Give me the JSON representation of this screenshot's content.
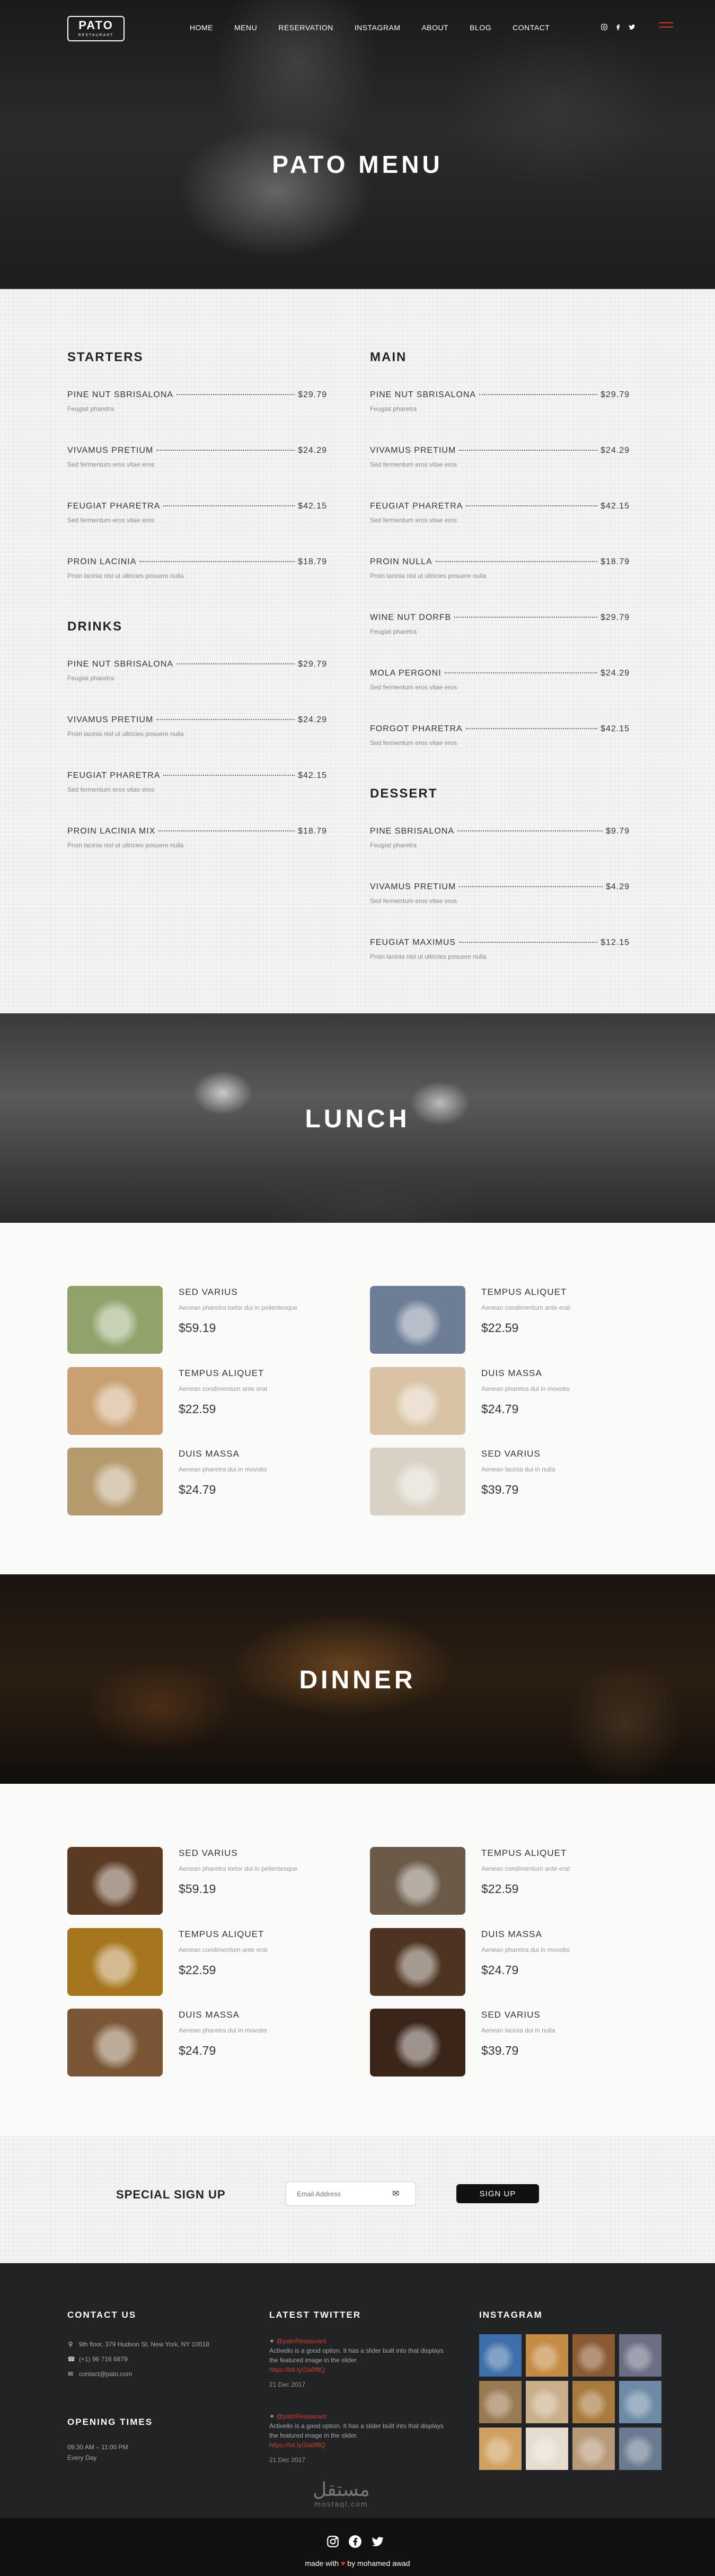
{
  "nav": {
    "logo_main": "PATO",
    "logo_sub": "RESTAURANT",
    "links": [
      "HOME",
      "MENU",
      "RESERVATION",
      "INSTAGRAM",
      "ABOUT",
      "BLOG",
      "CONTACT"
    ],
    "social_icons": [
      "instagram-icon",
      "facebook-icon",
      "twitter-icon"
    ]
  },
  "hero": {
    "title": "PATO MENU"
  },
  "menu": {
    "starters": {
      "title": "STARTERS",
      "items": [
        {
          "name": "PINE NUT SBRISALONA",
          "price": "$29.79",
          "desc": "Feugiat pharetra"
        },
        {
          "name": "VIVAMUS PRETIUM",
          "price": "$24.29",
          "desc": "Sed fermentum eros vitae eros"
        },
        {
          "name": "FEUGIAT PHARETRA",
          "price": "$42.15",
          "desc": "Sed fermentum eros vitae eros"
        },
        {
          "name": "PROIN LACINIA",
          "price": "$18.79",
          "desc": "Proin lacinia nisl ut ultricies posuere nulla"
        }
      ]
    },
    "drinks": {
      "title": "DRINKS",
      "items": [
        {
          "name": "PINE NUT SBRISALONA",
          "price": "$29.79",
          "desc": "Feugiat pharetra"
        },
        {
          "name": "VIVAMUS PRETIUM",
          "price": "$24.29",
          "desc": "Proin lacinia nisl ut ultricies posuere nulla"
        },
        {
          "name": "FEUGIAT PHARETRA",
          "price": "$42.15",
          "desc": "Sed fermentum eros vitae eros"
        },
        {
          "name": "PROIN LACINIA MIX",
          "price": "$18.79",
          "desc": "Proin lacinia nisl ut ultricies posuere nulla"
        }
      ]
    },
    "main": {
      "title": "MAIN",
      "items": [
        {
          "name": "PINE NUT SBRISALONA",
          "price": "$29.79",
          "desc": "Feugiat pharetra"
        },
        {
          "name": "VIVAMUS PRETIUM",
          "price": "$24.29",
          "desc": "Sed fermentum eros vitae eros"
        },
        {
          "name": "FEUGIAT PHARETRA",
          "price": "$42.15",
          "desc": "Sed fermentum eros vitae eros"
        },
        {
          "name": "PROIN NULLA",
          "price": "$18.79",
          "desc": "Proin lacinia nisl ut ultricies posuere nulla"
        },
        {
          "name": "WINE NUT DORFB",
          "price": "$29.79",
          "desc": "Feugiat pharetra"
        },
        {
          "name": "MOLA PERGONI",
          "price": "$24.29",
          "desc": "Sed fermentum eros vitae eros"
        },
        {
          "name": "FORGOT PHARETRA",
          "price": "$42.15",
          "desc": "Sed fermentum eros vitae eros"
        }
      ]
    },
    "dessert": {
      "title": "DESSERT",
      "items": [
        {
          "name": "PINE SBRISALONA",
          "price": "$9.79",
          "desc": "Feugiat pharetra"
        },
        {
          "name": "VIVAMUS PRETIUM",
          "price": "$4.29",
          "desc": "Sed fermentum eros vitae eros"
        },
        {
          "name": "FEUGIAT MAXIMUS",
          "price": "$12.15",
          "desc": "Proin lacinia nisl ut ultricies posuere nulla"
        }
      ]
    }
  },
  "lunch": {
    "title": "LUNCH",
    "dishes": [
      {
        "name": "SED VARIUS",
        "desc": "Aenean pharetra tortor dui in pellentesque",
        "price": "$59.19",
        "color": "#8fa36a"
      },
      {
        "name": "TEMPUS ALIQUET",
        "desc": "Aenean condimentum ante erat",
        "price": "$22.59",
        "color": "#6c7d95"
      },
      {
        "name": "TEMPUS ALIQUET",
        "desc": "Aenean condimentum ante erat",
        "price": "$22.59",
        "color": "#c9a072"
      },
      {
        "name": "DUIS MASSA",
        "desc": "Aenean pharetra dui in movobs",
        "price": "$24.79",
        "color": "#d8c3a5"
      },
      {
        "name": "DUIS MASSA",
        "desc": "Aenean pharetra dui in movobs",
        "price": "$24.79",
        "color": "#b59a6e"
      },
      {
        "name": "SED VARIUS",
        "desc": "Aenean lacinia dui in nulla",
        "price": "$39.79",
        "color": "#d9d2c4"
      }
    ]
  },
  "dinner": {
    "title": "DINNER",
    "dishes": [
      {
        "name": "SED VARIUS",
        "desc": "Aenean pharetra tortor dui in pellentesque",
        "price": "$59.19",
        "color": "#5a3a22"
      },
      {
        "name": "TEMPUS ALIQUET",
        "desc": "Aenean condimentum ante erat",
        "price": "$22.59",
        "color": "#6b5a48"
      },
      {
        "name": "TEMPUS ALIQUET",
        "desc": "Aenean condimentum ante erat",
        "price": "$22.59",
        "color": "#a6761e"
      },
      {
        "name": "DUIS MASSA",
        "desc": "Aenean pharetra dui in movobs",
        "price": "$24.79",
        "color": "#4d3320"
      },
      {
        "name": "DUIS MASSA",
        "desc": "Aenean pharetra dui in movobs",
        "price": "$24.79",
        "color": "#7a5634"
      },
      {
        "name": "SED VARIUS",
        "desc": "Aenean lacinia dui in nulla",
        "price": "$39.79",
        "color": "#3b2418"
      }
    ]
  },
  "signup": {
    "title": "SPECIAL SIGN UP",
    "placeholder": "Email Address",
    "button": "SIGN UP"
  },
  "footer": {
    "contact_title": "CONTACT US",
    "address": "9th floor, 379 Hudson St, New York, NY 10018",
    "phone": "(+1) 96 716 6879",
    "email": "contact@pato.com",
    "hours_title": "OPENING TIMES",
    "hours": "09:30 AM – 11:00 PM",
    "days": "Every Day",
    "twitter_title": "LATEST TWITTER",
    "tweets": [
      {
        "handle": "@patoRestaurant",
        "text": "Activello is a good option. It has a slider built into that displays the featured image in the slider.",
        "link": "https://bit.ly/2ia0ffiQ",
        "date": "21 Dec 2017"
      },
      {
        "handle": "@patoRestaurant",
        "text": "Activello is a good option. It has a slider built into that displays the featured image in the slider.",
        "link": "https://bit.ly/2ia0ffiQ",
        "date": "21 Dec 2017"
      }
    ],
    "instagram_title": "INSTAGRAM",
    "instagram_colors": [
      "#3e6fa8",
      "#c58b45",
      "#8a5a32",
      "#6c6f84",
      "#9a7a52",
      "#c9b08a",
      "#a87a3e",
      "#6e8aa6",
      "#d0a060",
      "#e6ddd0",
      "#b89a7a",
      "#6a7a90"
    ],
    "watermark_ar": "مستقل",
    "watermark_lat": "mostaql.com",
    "credit_prefix": "made with",
    "credit_heart": "♥",
    "credit_suffix": "by mohamed awad"
  }
}
